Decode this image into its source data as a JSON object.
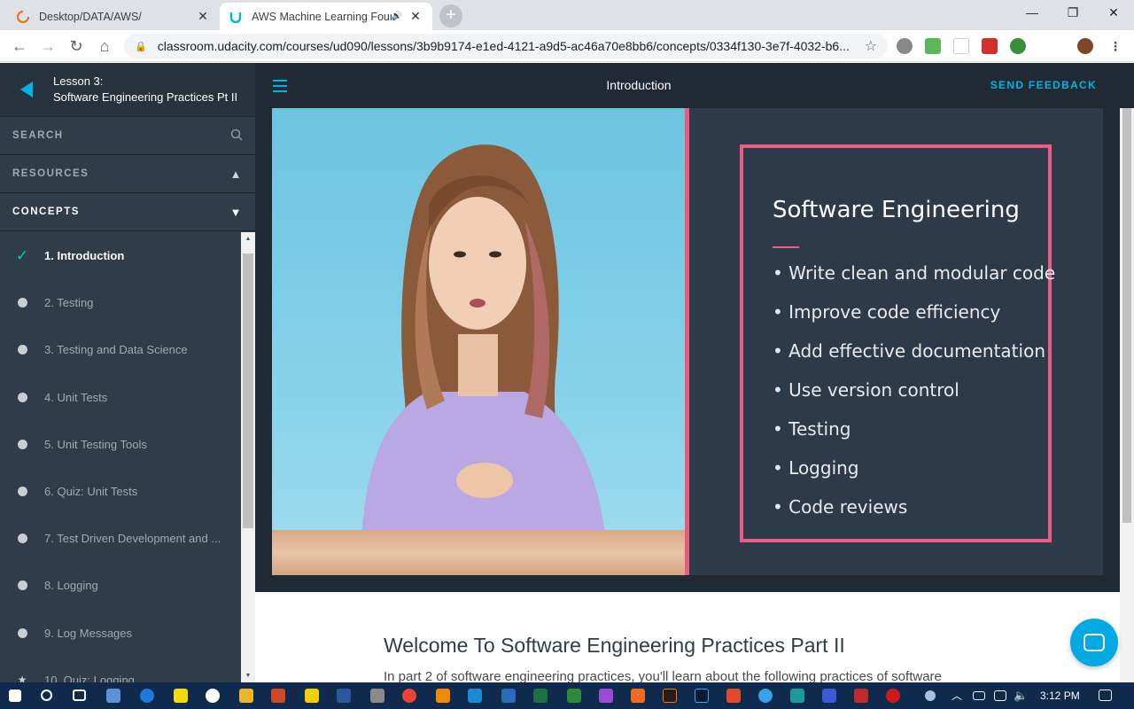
{
  "browser": {
    "tabs": [
      {
        "title": "Desktop/DATA/AWS/",
        "close": "✕"
      },
      {
        "title": "AWS Machine Learning Foun",
        "close": "✕",
        "audio": "🔊"
      }
    ],
    "new_tab": "+",
    "window_controls": {
      "minimize": "—",
      "restore": "❐",
      "close": "✕"
    },
    "nav": {
      "back": "←",
      "forward": "→",
      "reload": "↻",
      "home": "⌂"
    },
    "url": "classroom.udacity.com/courses/ud090/lessons/3b9b9174-e1ed-4121-a9d5-ac46a70e8bb6/concepts/0334f130-3e7f-4032-b6...",
    "bookmark_icon": "☆"
  },
  "sidebar": {
    "lesson_line1": "Lesson 3:",
    "lesson_line2": "Software Engineering Practices Pt II",
    "search_label": "SEARCH",
    "resources_label": "RESOURCES",
    "concepts_label": "CONCEPTS",
    "concepts": [
      {
        "label": "1. Introduction",
        "state": "complete"
      },
      {
        "label": "2. Testing",
        "state": "pending"
      },
      {
        "label": "3. Testing and Data Science",
        "state": "pending"
      },
      {
        "label": "4. Unit Tests",
        "state": "pending"
      },
      {
        "label": "5. Unit Testing Tools",
        "state": "pending"
      },
      {
        "label": "6. Quiz: Unit Tests",
        "state": "pending"
      },
      {
        "label": "7. Test Driven Development and ...",
        "state": "pending"
      },
      {
        "label": "8. Logging",
        "state": "pending"
      },
      {
        "label": "9. Log Messages",
        "state": "pending"
      },
      {
        "label": "10. Quiz: Logging",
        "state": "quiz"
      }
    ]
  },
  "header": {
    "title": "Introduction",
    "feedback": "SEND FEEDBACK"
  },
  "slide": {
    "title": "Software Engineering",
    "bullets": [
      "• Write clean and modular code",
      "• Improve code efficiency",
      "• Add effective documentation",
      "• Use version control",
      "• Testing",
      "• Logging",
      "• Code reviews"
    ]
  },
  "article": {
    "heading": "Welcome To Software Engineering Practices Part II",
    "intro": "In part 2 of software engineering practices, you'll learn about the following practices of software"
  },
  "taskbar": {
    "time": "3:12 PM"
  },
  "colors": {
    "accent": "#02b3e4",
    "sidebar_bg": "#2e3d49",
    "slide_pink": "#ec5c83",
    "check": "#02ccba"
  }
}
